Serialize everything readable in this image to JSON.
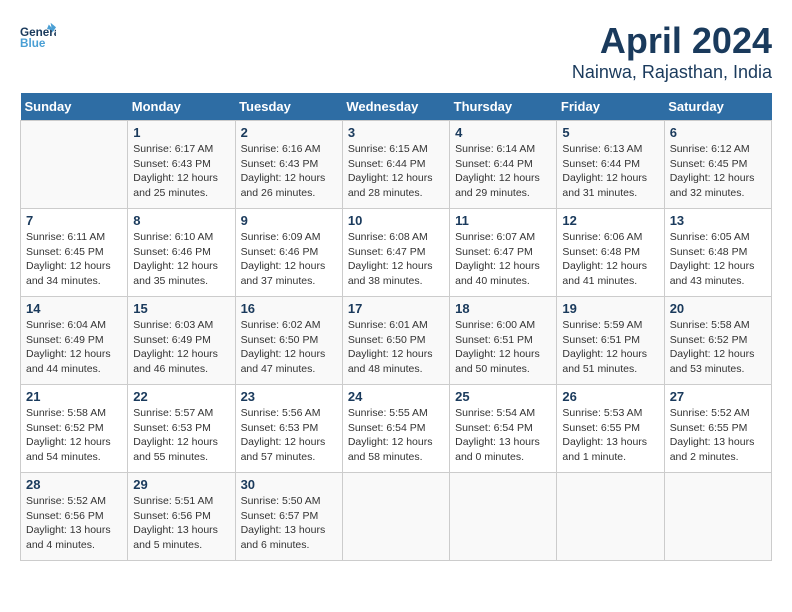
{
  "header": {
    "logo_general": "General",
    "logo_blue": "Blue",
    "title": "April 2024",
    "subtitle": "Nainwa, Rajasthan, India"
  },
  "days_of_week": [
    "Sunday",
    "Monday",
    "Tuesday",
    "Wednesday",
    "Thursday",
    "Friday",
    "Saturday"
  ],
  "weeks": [
    [
      {
        "day": "",
        "info": ""
      },
      {
        "day": "1",
        "info": "Sunrise: 6:17 AM\nSunset: 6:43 PM\nDaylight: 12 hours\nand 25 minutes."
      },
      {
        "day": "2",
        "info": "Sunrise: 6:16 AM\nSunset: 6:43 PM\nDaylight: 12 hours\nand 26 minutes."
      },
      {
        "day": "3",
        "info": "Sunrise: 6:15 AM\nSunset: 6:44 PM\nDaylight: 12 hours\nand 28 minutes."
      },
      {
        "day": "4",
        "info": "Sunrise: 6:14 AM\nSunset: 6:44 PM\nDaylight: 12 hours\nand 29 minutes."
      },
      {
        "day": "5",
        "info": "Sunrise: 6:13 AM\nSunset: 6:44 PM\nDaylight: 12 hours\nand 31 minutes."
      },
      {
        "day": "6",
        "info": "Sunrise: 6:12 AM\nSunset: 6:45 PM\nDaylight: 12 hours\nand 32 minutes."
      }
    ],
    [
      {
        "day": "7",
        "info": "Sunrise: 6:11 AM\nSunset: 6:45 PM\nDaylight: 12 hours\nand 34 minutes."
      },
      {
        "day": "8",
        "info": "Sunrise: 6:10 AM\nSunset: 6:46 PM\nDaylight: 12 hours\nand 35 minutes."
      },
      {
        "day": "9",
        "info": "Sunrise: 6:09 AM\nSunset: 6:46 PM\nDaylight: 12 hours\nand 37 minutes."
      },
      {
        "day": "10",
        "info": "Sunrise: 6:08 AM\nSunset: 6:47 PM\nDaylight: 12 hours\nand 38 minutes."
      },
      {
        "day": "11",
        "info": "Sunrise: 6:07 AM\nSunset: 6:47 PM\nDaylight: 12 hours\nand 40 minutes."
      },
      {
        "day": "12",
        "info": "Sunrise: 6:06 AM\nSunset: 6:48 PM\nDaylight: 12 hours\nand 41 minutes."
      },
      {
        "day": "13",
        "info": "Sunrise: 6:05 AM\nSunset: 6:48 PM\nDaylight: 12 hours\nand 43 minutes."
      }
    ],
    [
      {
        "day": "14",
        "info": "Sunrise: 6:04 AM\nSunset: 6:49 PM\nDaylight: 12 hours\nand 44 minutes."
      },
      {
        "day": "15",
        "info": "Sunrise: 6:03 AM\nSunset: 6:49 PM\nDaylight: 12 hours\nand 46 minutes."
      },
      {
        "day": "16",
        "info": "Sunrise: 6:02 AM\nSunset: 6:50 PM\nDaylight: 12 hours\nand 47 minutes."
      },
      {
        "day": "17",
        "info": "Sunrise: 6:01 AM\nSunset: 6:50 PM\nDaylight: 12 hours\nand 48 minutes."
      },
      {
        "day": "18",
        "info": "Sunrise: 6:00 AM\nSunset: 6:51 PM\nDaylight: 12 hours\nand 50 minutes."
      },
      {
        "day": "19",
        "info": "Sunrise: 5:59 AM\nSunset: 6:51 PM\nDaylight: 12 hours\nand 51 minutes."
      },
      {
        "day": "20",
        "info": "Sunrise: 5:58 AM\nSunset: 6:52 PM\nDaylight: 12 hours\nand 53 minutes."
      }
    ],
    [
      {
        "day": "21",
        "info": "Sunrise: 5:58 AM\nSunset: 6:52 PM\nDaylight: 12 hours\nand 54 minutes."
      },
      {
        "day": "22",
        "info": "Sunrise: 5:57 AM\nSunset: 6:53 PM\nDaylight: 12 hours\nand 55 minutes."
      },
      {
        "day": "23",
        "info": "Sunrise: 5:56 AM\nSunset: 6:53 PM\nDaylight: 12 hours\nand 57 minutes."
      },
      {
        "day": "24",
        "info": "Sunrise: 5:55 AM\nSunset: 6:54 PM\nDaylight: 12 hours\nand 58 minutes."
      },
      {
        "day": "25",
        "info": "Sunrise: 5:54 AM\nSunset: 6:54 PM\nDaylight: 13 hours\nand 0 minutes."
      },
      {
        "day": "26",
        "info": "Sunrise: 5:53 AM\nSunset: 6:55 PM\nDaylight: 13 hours\nand 1 minute."
      },
      {
        "day": "27",
        "info": "Sunrise: 5:52 AM\nSunset: 6:55 PM\nDaylight: 13 hours\nand 2 minutes."
      }
    ],
    [
      {
        "day": "28",
        "info": "Sunrise: 5:52 AM\nSunset: 6:56 PM\nDaylight: 13 hours\nand 4 minutes."
      },
      {
        "day": "29",
        "info": "Sunrise: 5:51 AM\nSunset: 6:56 PM\nDaylight: 13 hours\nand 5 minutes."
      },
      {
        "day": "30",
        "info": "Sunrise: 5:50 AM\nSunset: 6:57 PM\nDaylight: 13 hours\nand 6 minutes."
      },
      {
        "day": "",
        "info": ""
      },
      {
        "day": "",
        "info": ""
      },
      {
        "day": "",
        "info": ""
      },
      {
        "day": "",
        "info": ""
      }
    ]
  ]
}
